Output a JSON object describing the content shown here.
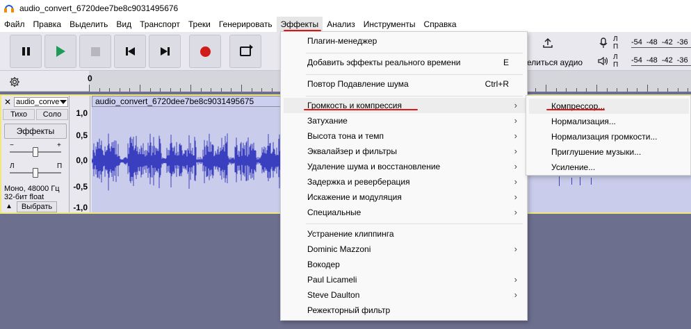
{
  "window": {
    "title": "audio_convert_6720dee7be8c9031495676"
  },
  "menubar": {
    "items": [
      "Файл",
      "Правка",
      "Выделить",
      "Вид",
      "Транспорт",
      "Треки",
      "Генерировать",
      "Эффекты",
      "Анализ",
      "Инструменты",
      "Справка"
    ],
    "active": "Эффекты"
  },
  "toolbar": {
    "share_label": "елиться аудио",
    "buttons": [
      "pause-icon",
      "play-icon",
      "stop-icon",
      "skip-to-start-icon",
      "skip-to-end-icon",
      "record-icon",
      "loop-icon"
    ],
    "meters": {
      "rec_label": "Л\nП",
      "play_label": "Л\nП",
      "scale": [
        "-54",
        "-48",
        "-42",
        "-36"
      ]
    }
  },
  "timeline": {
    "start": "0"
  },
  "track": {
    "name": "audio_conve",
    "mute": "Тихо",
    "solo": "Соло",
    "effects": "Эффекты",
    "gain_minus": "−",
    "gain_plus": "+",
    "pan_left": "Л",
    "pan_right": "П",
    "info_line1": "Моно, 48000 Гц",
    "info_line2": "32-бит float",
    "select": "Выбрать",
    "scale": [
      "1,0",
      "0,5",
      "0,0",
      "-0,5",
      "-1,0"
    ],
    "clip_title": "audio_convert_6720dee7be8c9031495675",
    "colors": {
      "waveform": "#3a3fc0",
      "clip_bg": "#c9ccea",
      "selection_border": "#f0e97a"
    }
  },
  "effects_menu": {
    "items": [
      {
        "label": "Плагин-менеджер",
        "shortcut": "",
        "submenu": false
      },
      {
        "label": "Добавить эффекты реального времени",
        "shortcut": "E",
        "submenu": false
      },
      {
        "label": "Повтор Подавление шума",
        "shortcut": "Ctrl+R",
        "submenu": false
      },
      {
        "label": "Громкость и компрессия",
        "shortcut": "",
        "submenu": true
      },
      {
        "label": "Затухание",
        "shortcut": "",
        "submenu": true
      },
      {
        "label": "Высота тона и темп",
        "shortcut": "",
        "submenu": true
      },
      {
        "label": "Эквалайзер и фильтры",
        "shortcut": "",
        "submenu": true
      },
      {
        "label": "Удаление шума и восстановление",
        "shortcut": "",
        "submenu": true
      },
      {
        "label": "Задержка и реверберация",
        "shortcut": "",
        "submenu": true
      },
      {
        "label": "Искажение и модуляция",
        "shortcut": "",
        "submenu": true
      },
      {
        "label": "Специальные",
        "shortcut": "",
        "submenu": true
      },
      {
        "label": "Устранение клиппинга",
        "shortcut": "",
        "submenu": false
      },
      {
        "label": "Dominic Mazzoni",
        "shortcut": "",
        "submenu": true
      },
      {
        "label": "Вокодер",
        "shortcut": "",
        "submenu": false
      },
      {
        "label": "Paul Licameli",
        "shortcut": "",
        "submenu": true
      },
      {
        "label": "Steve Daulton",
        "shortcut": "",
        "submenu": true
      },
      {
        "label": "Режекторный фильтр",
        "shortcut": "",
        "submenu": false
      }
    ],
    "arrow": "›"
  },
  "submenu": {
    "items": [
      "Компрессор...",
      "Нормализация...",
      "Нормализация громкости...",
      "Приглушение музыки...",
      "Усиление..."
    ]
  }
}
